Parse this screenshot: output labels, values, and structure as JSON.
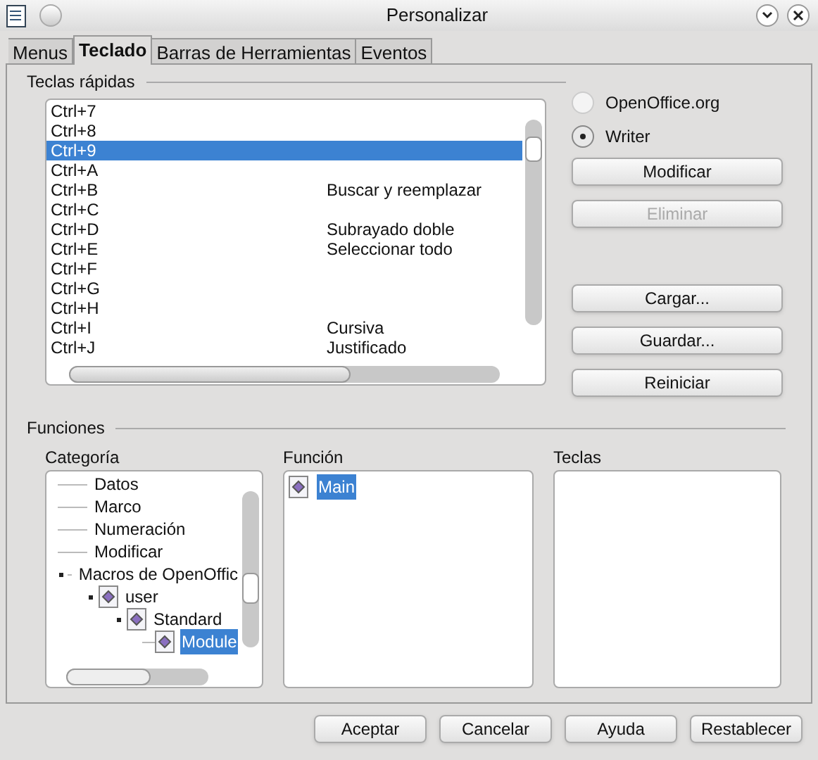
{
  "window": {
    "title": "Personalizar"
  },
  "tabs": [
    {
      "label": "Menus",
      "selected": false
    },
    {
      "label": "Teclado",
      "selected": true
    },
    {
      "label": "Barras de Herramientas",
      "selected": false
    },
    {
      "label": "Eventos",
      "selected": false
    }
  ],
  "shortcuts": {
    "title": "Teclas rápidas",
    "rows": [
      {
        "key": "Ctrl+7",
        "function": "",
        "selected": false
      },
      {
        "key": "Ctrl+8",
        "function": "",
        "selected": false
      },
      {
        "key": "Ctrl+9",
        "function": "",
        "selected": true
      },
      {
        "key": "Ctrl+A",
        "function": "",
        "selected": false
      },
      {
        "key": "Ctrl+B",
        "function": "Buscar y reemplazar",
        "selected": false
      },
      {
        "key": "Ctrl+C",
        "function": "",
        "selected": false
      },
      {
        "key": "Ctrl+D",
        "function": "Subrayado doble",
        "selected": false
      },
      {
        "key": "Ctrl+E",
        "function": "Seleccionar todo",
        "selected": false
      },
      {
        "key": "Ctrl+F",
        "function": "",
        "selected": false
      },
      {
        "key": "Ctrl+G",
        "function": "",
        "selected": false
      },
      {
        "key": "Ctrl+H",
        "function": "",
        "selected": false
      },
      {
        "key": "Ctrl+I",
        "function": "Cursiva",
        "selected": false
      },
      {
        "key": "Ctrl+J",
        "function": "Justificado",
        "selected": false
      }
    ]
  },
  "scope": [
    {
      "label": "OpenOffice.org",
      "selected": false
    },
    {
      "label": "Writer",
      "selected": true
    }
  ],
  "side_buttons": [
    {
      "label": "Modificar",
      "disabled": false
    },
    {
      "label": "Eliminar",
      "disabled": true
    },
    {
      "label": "Cargar...",
      "disabled": false
    },
    {
      "label": "Guardar...",
      "disabled": false
    },
    {
      "label": "Reiniciar",
      "disabled": false
    }
  ],
  "functions": {
    "title": "Funciones",
    "category": {
      "label": "Categoría",
      "tree": [
        {
          "label": "Datos",
          "selected": false
        },
        {
          "label": "Marco",
          "selected": false
        },
        {
          "label": "Numeración",
          "selected": false
        },
        {
          "label": "Modificar",
          "selected": false
        },
        {
          "label": "Macros de OpenOffic",
          "selected": false,
          "expanded": true,
          "children": [
            {
              "label": "user",
              "selected": false,
              "expanded": true,
              "children": [
                {
                  "label": "Standard",
                  "selected": false,
                  "expanded": true,
                  "children": [
                    {
                      "label": "Module",
                      "selected": true
                    }
                  ]
                }
              ]
            }
          ]
        }
      ]
    },
    "function": {
      "label": "Función",
      "items": [
        {
          "label": "Main",
          "selected": true
        }
      ]
    },
    "keys": {
      "label": "Teclas"
    }
  },
  "footer_buttons": [
    "Aceptar",
    "Cancelar",
    "Ayuda",
    "Restablecer"
  ]
}
